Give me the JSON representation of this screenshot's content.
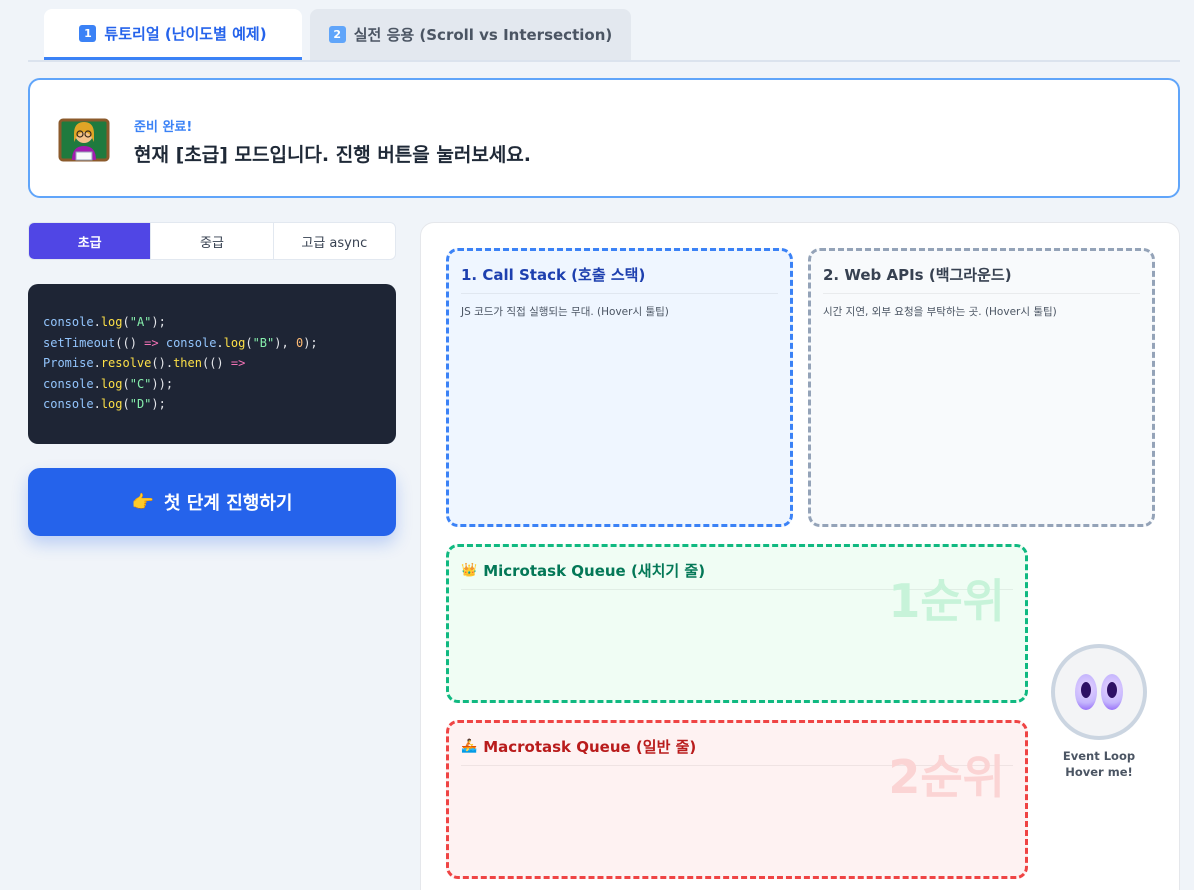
{
  "tabs": [
    {
      "num": "1",
      "label": "튜토리얼 (난이도별 예제)",
      "active": true
    },
    {
      "num": "2",
      "label": "실전 응용 (Scroll vs Intersection)",
      "active": false
    }
  ],
  "status": {
    "sub": "준비 완료!",
    "main": "현재 [초급] 모드입니다. 진행 버튼을 눌러보세요."
  },
  "levels": [
    "초급",
    "중급",
    "고급 async"
  ],
  "code_lines": [
    "console.log(\"A\");",
    "setTimeout(() => console.log(\"B\"), 0);",
    "Promise.resolve().then(() =>",
    "console.log(\"C\"));",
    "console.log(\"D\");"
  ],
  "run_button": {
    "icon": "👉",
    "label": "첫 단계 진행하기"
  },
  "boxes": {
    "callstack": {
      "title": "1. Call Stack (호출 스택)",
      "desc": "JS 코드가 직접 실행되는 무대. (Hover시 툴팁)"
    },
    "webapi": {
      "title": "2. Web APIs (백그라운드)",
      "desc": "시간 지연, 외부 요청을 부탁하는 곳. (Hover시 툴팁)"
    },
    "micro": {
      "icon": "👑",
      "title": "Microtask Queue (새치기 줄)",
      "priority": "1순위"
    },
    "macro": {
      "icon": "🚣",
      "title": "Macrotask Queue (일반 줄)",
      "priority": "2순위"
    }
  },
  "eventloop": {
    "line1": "Event Loop",
    "line2": "Hover me!"
  },
  "colors": {
    "accent": "#2563eb",
    "active_level": "#5046e5",
    "micro": "#10b981",
    "macro": "#ef4444"
  }
}
